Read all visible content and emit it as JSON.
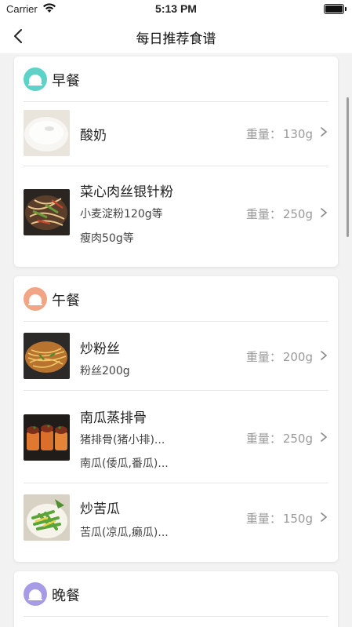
{
  "status_bar": {
    "carrier": "Carrier",
    "time": "5:13 PM"
  },
  "nav": {
    "title": "每日推荐食谱"
  },
  "weight_prefix": "重量：",
  "meals": {
    "breakfast": {
      "title": "早餐",
      "color": "#5fd2c8",
      "items": [
        {
          "name": "酸奶",
          "ingredients": [],
          "weight": "130g"
        },
        {
          "name": "菜心肉丝银针粉",
          "ingredients": [
            "小麦淀粉120g等",
            "瘦肉50g等"
          ],
          "weight": "250g"
        }
      ]
    },
    "lunch": {
      "title": "午餐",
      "color": "#f2a584",
      "items": [
        {
          "name": "炒粉丝",
          "ingredients": [
            "粉丝200g"
          ],
          "weight": "200g"
        },
        {
          "name": "南瓜蒸排骨",
          "ingredients": [
            "猪排骨(猪小排)...",
            "南瓜(倭瓜,番瓜)..."
          ],
          "weight": "250g"
        },
        {
          "name": "炒苦瓜",
          "ingredients": [
            "苦瓜(凉瓜,癞瓜)..."
          ],
          "weight": "150g"
        }
      ]
    },
    "dinner": {
      "title": "晚餐",
      "color": "#a89be6",
      "items": []
    }
  }
}
